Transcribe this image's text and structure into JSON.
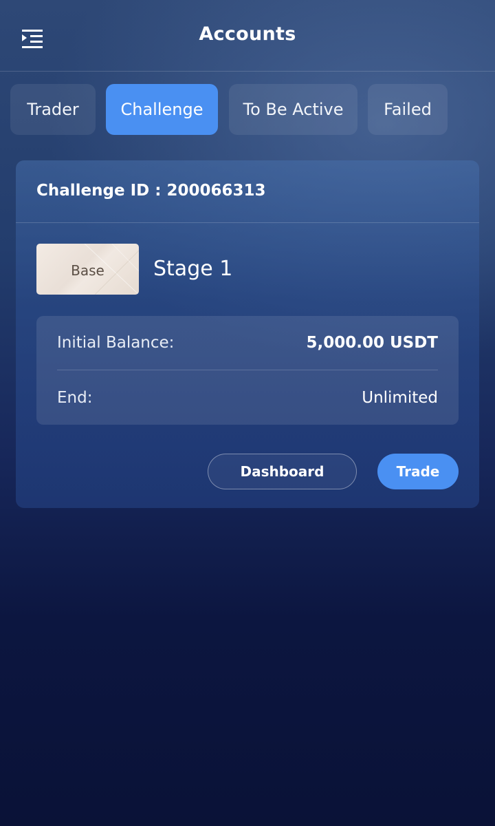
{
  "header": {
    "title": "Accounts",
    "menu_icon": "menu-collapse-icon"
  },
  "tabs": [
    {
      "label": "Trader",
      "active": false
    },
    {
      "label": "Challenge",
      "active": true
    },
    {
      "label": "To Be Active",
      "active": false
    },
    {
      "label": "Failed",
      "active": false
    }
  ],
  "card": {
    "challenge_id": "Challenge ID : 200066313",
    "badge_label": "Base",
    "stage": "Stage 1",
    "info": [
      {
        "label": "Initial Balance:",
        "value": "5,000.00 USDT"
      },
      {
        "label": "End:",
        "value": "Unlimited"
      }
    ],
    "buttons": {
      "dashboard": "Dashboard",
      "trade": "Trade"
    }
  },
  "colors": {
    "accent": "#4a90f2",
    "badge_text": "#5b4f45"
  }
}
